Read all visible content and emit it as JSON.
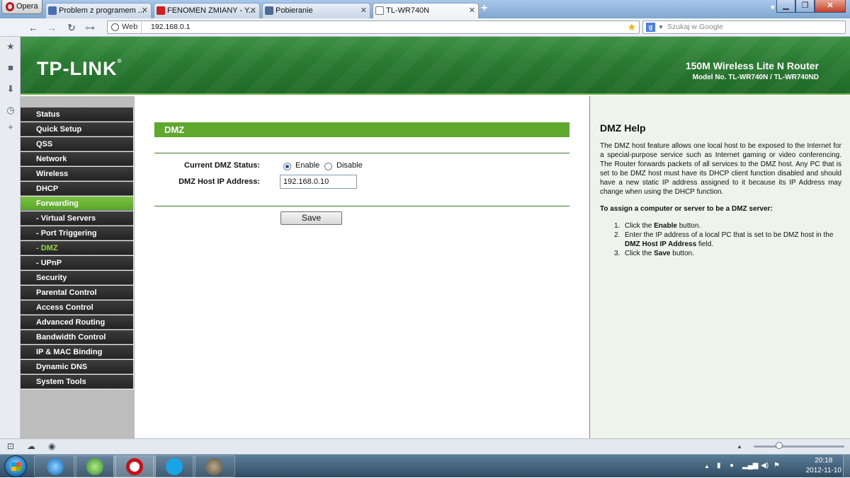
{
  "browser": {
    "opera_button": "Opera",
    "tabs": [
      {
        "label": "Problem z programem ...",
        "color": "#4a6fb0"
      },
      {
        "label": "FENOMEN ZMIANY - Y...",
        "color": "#d21e1e"
      },
      {
        "label": "Pobieranie",
        "color": "#4d6b93"
      },
      {
        "label": "TL-WR740N",
        "color": "#ffffff"
      }
    ],
    "address": {
      "mode": "Web",
      "url": "192.168.0.1"
    },
    "search_placeholder": "Szukaj w Google"
  },
  "router": {
    "logo": "TP-LINK",
    "logo_mark": "®",
    "product_title": "150M Wireless Lite N Router",
    "model": "Model No. TL-WR740N / TL-WR740ND",
    "menu": [
      {
        "label": "Status"
      },
      {
        "label": "Quick Setup"
      },
      {
        "label": "QSS"
      },
      {
        "label": "Network"
      },
      {
        "label": "Wireless"
      },
      {
        "label": "DHCP"
      },
      {
        "label": "Forwarding",
        "active": true
      },
      {
        "label": "- Virtual Servers"
      },
      {
        "label": "- Port Triggering"
      },
      {
        "label": "- DMZ",
        "selected": true
      },
      {
        "label": "- UPnP"
      },
      {
        "label": "Security"
      },
      {
        "label": "Parental Control"
      },
      {
        "label": "Access Control"
      },
      {
        "label": "Advanced Routing"
      },
      {
        "label": "Bandwidth Control"
      },
      {
        "label": "IP & MAC Binding"
      },
      {
        "label": "Dynamic DNS"
      },
      {
        "label": "System Tools"
      }
    ],
    "dmz": {
      "title": "DMZ",
      "status_label": "Current DMZ Status:",
      "enable_label": "Enable",
      "disable_label": "Disable",
      "selected_status": "Enable",
      "host_ip_label": "DMZ Host IP Address:",
      "host_ip_value": "192.168.0.10",
      "save_label": "Save"
    },
    "help": {
      "title": "DMZ Help",
      "intro": "The DMZ host feature allows one local host to be exposed to the Internet for a special-purpose service such as Internet gaming or video conferencing. The Router forwards packets of all services to the DMZ host. Any PC that is set to be DMZ host must have its DHCP client function disabled and should have a new static IP address assigned to it because its IP Address may change when using the DHCP function.",
      "howto_title": "To assign a computer or server to be a DMZ server:",
      "steps": [
        {
          "n": "1.",
          "pre": "Click the ",
          "bold": "Enable",
          "post": " button."
        },
        {
          "n": "2.",
          "pre": "Enter the IP address of a local PC that is set to be DMZ host in the ",
          "bold": "DMZ Host IP Address",
          "post": " field."
        },
        {
          "n": "3.",
          "pre": "Click the ",
          "bold": "Save",
          "post": " button."
        }
      ]
    }
  },
  "taskbar": {
    "clock_time": "20:18",
    "clock_date": "2012-11-10"
  }
}
